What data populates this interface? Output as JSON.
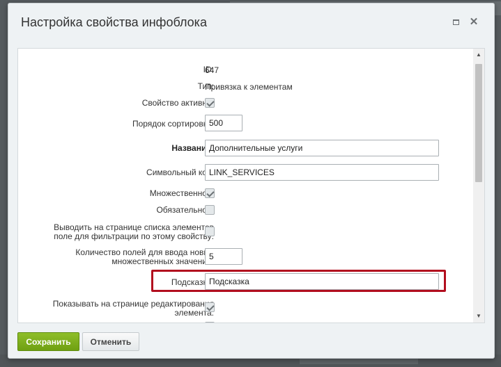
{
  "dialog": {
    "title": "Настройка свойства инфоблока"
  },
  "fields": {
    "id_label": "ID:",
    "id_value": "647",
    "type_label": "Тип:",
    "type_value": "Привязка к элементам",
    "active_label": "Свойство активно:",
    "active_checked": true,
    "sort_label": "Порядок сортировки:",
    "sort_value": "500",
    "name_label": "Название:",
    "name_value": "Дополнительные услуги",
    "code_label": "Символьный код:",
    "code_value": "LINK_SERVICES",
    "multiple_label": "Множественное:",
    "multiple_checked": true,
    "required_label": "Обязательное:",
    "required_checked": false,
    "filter_label_line1": "Выводить на странице списка элементов",
    "filter_label_line2": "поле для фильтрации по этому свойству:",
    "filter_checked": false,
    "multi_count_label_line1": "Количество полей для ввода новых",
    "multi_count_label_line2": "множественных значений:",
    "multi_count_value": "5",
    "hint_label": "Подсказка:",
    "hint_value": "Подсказка",
    "show_edit_label_line1": "Показывать на странице редактирования",
    "show_edit_label_line2": "элемента:",
    "show_edit_checked": true
  },
  "footer": {
    "save_label": "Сохранить",
    "cancel_label": "Отменить"
  },
  "colors": {
    "save_button": "#7aab19",
    "highlight_border": "#b20e1e"
  }
}
